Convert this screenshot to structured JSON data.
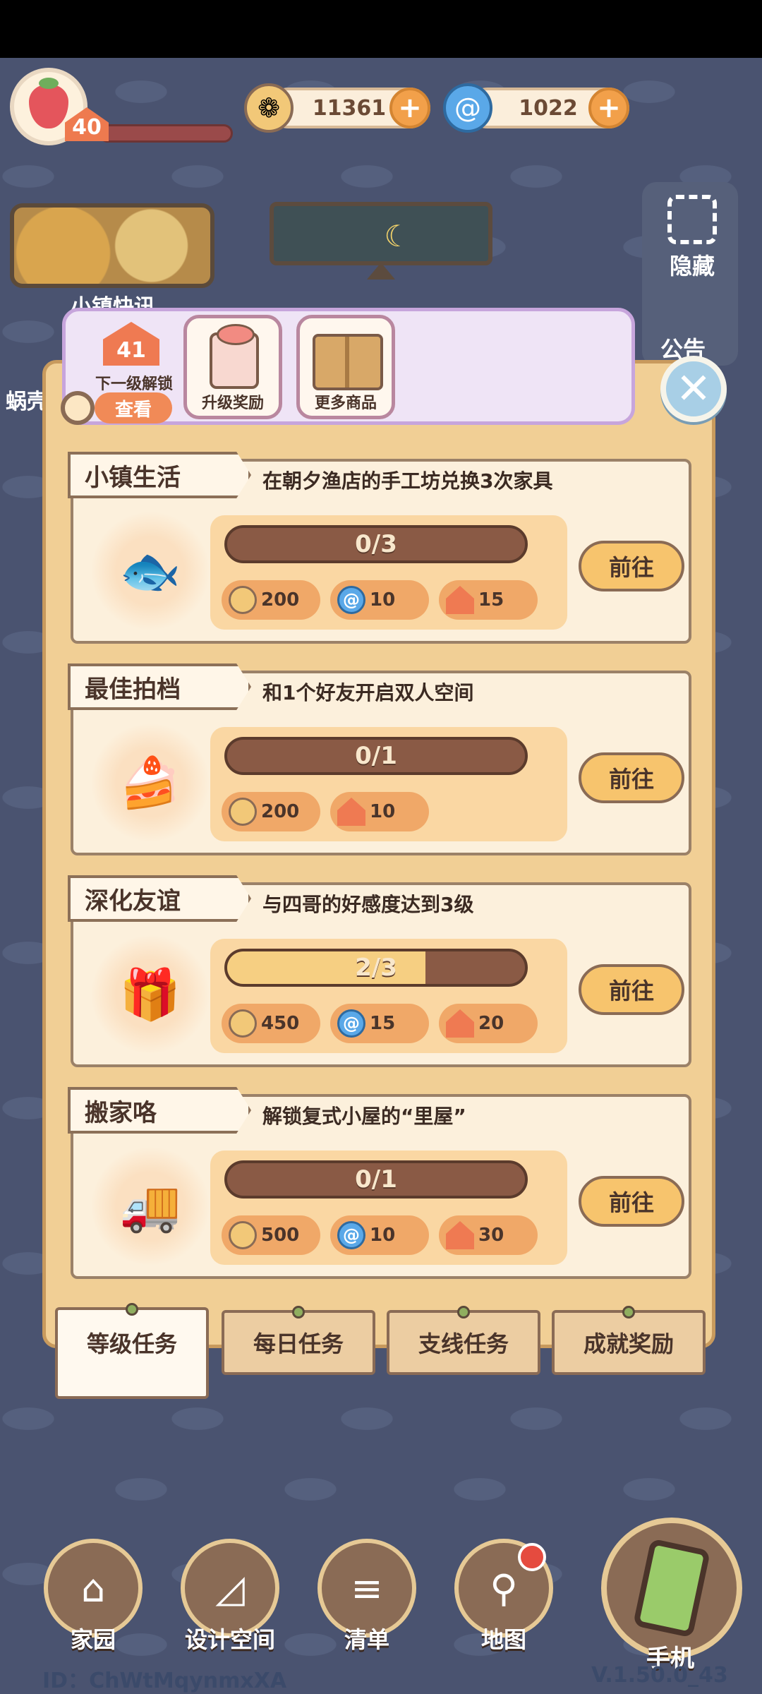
{
  "hud": {
    "level": "40",
    "coins": "11361",
    "gems": "1022",
    "plus": "+"
  },
  "side": {
    "news_label": "小镇快讯",
    "hide_label": "隐藏",
    "announce_label": "公告",
    "snail_label": "蜗壳"
  },
  "top_bar": {
    "next_level": "41",
    "next_unlock_label": "下一级解锁",
    "view_button": "查看",
    "upgrade_reward_label": "升级奖励",
    "more_goods_label": "更多商品",
    "close": "✕"
  },
  "tasks": [
    {
      "title": "小镇生活",
      "description": "在朝夕渔店的手工坊兑换3次家具",
      "progress_text": "0/3",
      "progress": 0.0,
      "rewards": {
        "coin": "200",
        "gem": "10",
        "exp": "15"
      },
      "go_button": "前往",
      "art": "fish-rod-icon"
    },
    {
      "title": "最佳拍档",
      "description": "和1个好友开启双人空间",
      "progress_text": "0/1",
      "progress": 0.0,
      "rewards": {
        "coin": "200",
        "exp": "10"
      },
      "go_button": "前往",
      "art": "cake-icon"
    },
    {
      "title": "深化友谊",
      "description": "与四哥的好感度达到3级",
      "progress_text": "2/3",
      "progress": 0.667,
      "rewards": {
        "coin": "450",
        "gem": "15",
        "exp": "20"
      },
      "go_button": "前往",
      "art": "gift-icon"
    },
    {
      "title": "搬家咯",
      "description": "解锁复式小屋的“里屋”",
      "progress_text": "0/1",
      "progress": 0.0,
      "rewards": {
        "coin": "500",
        "gem": "10",
        "exp": "30"
      },
      "go_button": "前往",
      "art": "moving-truck-icon"
    }
  ],
  "tabs": [
    {
      "label": "等级任务",
      "active": true
    },
    {
      "label": "每日任务",
      "active": false
    },
    {
      "label": "支线任务",
      "active": false
    },
    {
      "label": "成就奖励",
      "active": false
    }
  ],
  "nav": {
    "home": "家园",
    "design": "设计空间",
    "list": "清单",
    "map": "地图",
    "phone": "手机"
  },
  "footer": {
    "user_id": "ID：ChWtMqynmxXA",
    "version": "V.1.50.0_43"
  },
  "colors": {
    "panel": "#f1cf95",
    "card": "#fcf0dc",
    "accent_orange": "#ef7a52",
    "button_yellow": "#f7c46d",
    "progress_bg": "#8a5a45",
    "progress_fill": "#f6cf82"
  }
}
